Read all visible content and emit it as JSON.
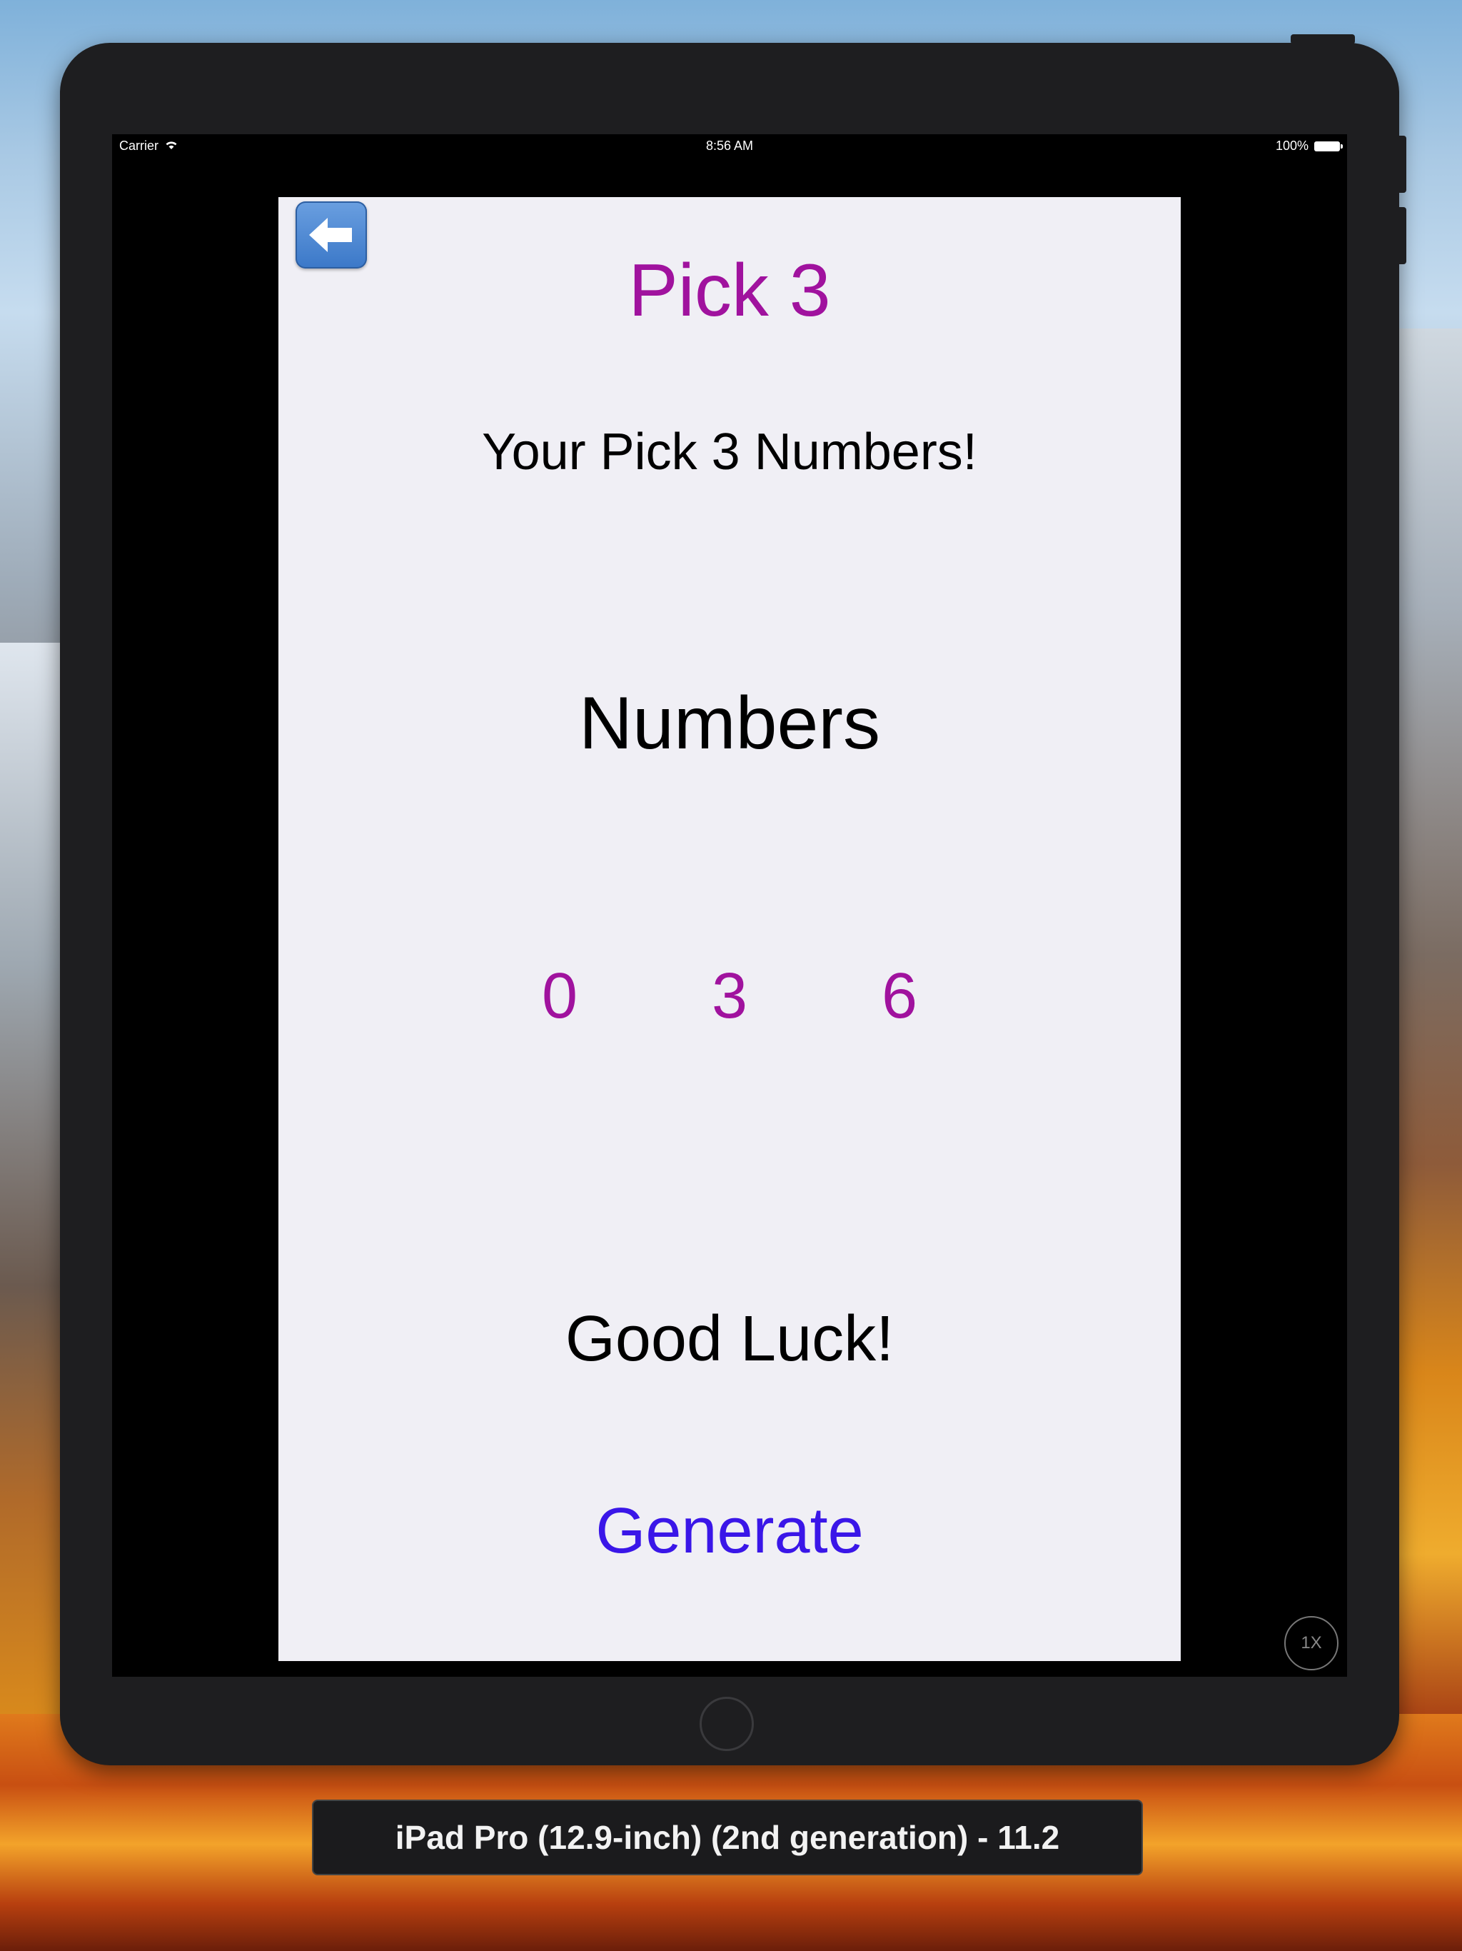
{
  "status_bar": {
    "carrier": "Carrier",
    "time": "8:56 AM",
    "battery": "100%"
  },
  "app": {
    "back_icon": "back-arrow-icon",
    "title": "Pick 3",
    "subtitle": "Your Pick 3 Numbers!",
    "numbers_label": "Numbers",
    "digits": [
      "0",
      "3",
      "6"
    ],
    "good_luck": "Good Luck!",
    "generate_label": "Generate"
  },
  "simulator": {
    "scale_badge": "1X",
    "device_label": "iPad Pro (12.9-inch) (2nd generation) - 11.2"
  },
  "colors": {
    "accent_purple": "#a0129e",
    "button_blue": "#3a16e8",
    "app_background": "#f0eff5"
  }
}
